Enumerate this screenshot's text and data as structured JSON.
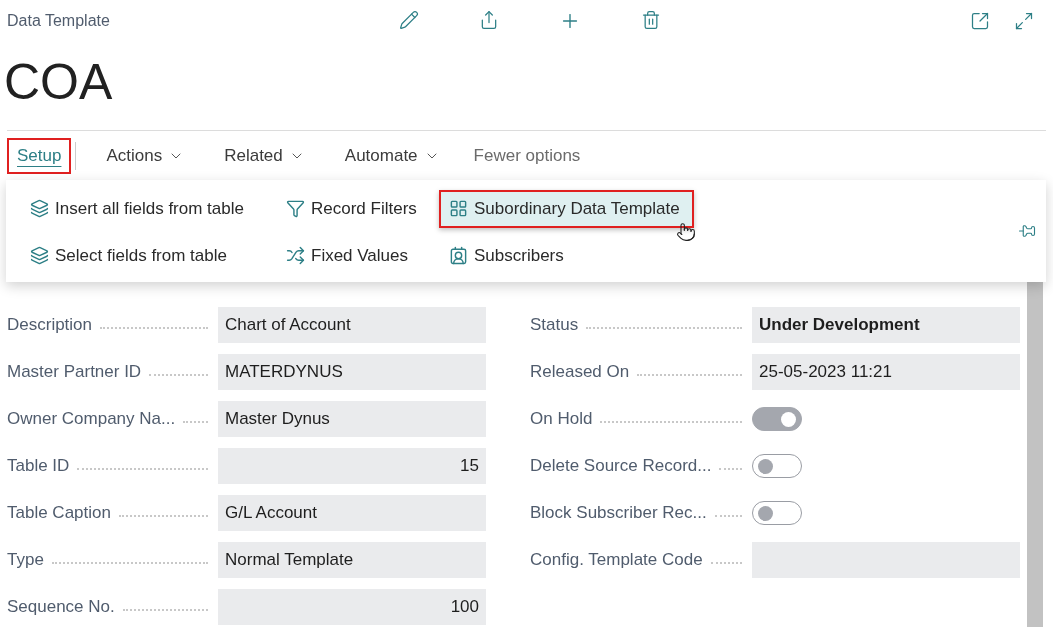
{
  "page": {
    "caption": "Data Template",
    "title": "COA"
  },
  "action_tabs": [
    {
      "label": "Setup",
      "selected": true,
      "annotated": true,
      "dropdown": false
    },
    {
      "label": "Actions",
      "selected": false,
      "annotated": false,
      "dropdown": true
    },
    {
      "label": "Related",
      "selected": false,
      "annotated": false,
      "dropdown": true
    },
    {
      "label": "Automate",
      "selected": false,
      "annotated": false,
      "dropdown": true
    }
  ],
  "fewer_options": "Fewer options",
  "menu_items": [
    {
      "label": "Insert all fields from table",
      "kind": "insert",
      "annotated": false,
      "hovered": false
    },
    {
      "label": "Record Filters",
      "kind": "filter",
      "annotated": false,
      "hovered": false
    },
    {
      "label": "Subordinary Data Template",
      "kind": "template",
      "annotated": true,
      "hovered": true
    },
    {
      "label": "Select fields from table",
      "kind": "insert",
      "annotated": false,
      "hovered": false
    },
    {
      "label": "Fixed Values",
      "kind": "fixed",
      "annotated": false,
      "hovered": false
    },
    {
      "label": "Subscribers",
      "kind": "subscribers",
      "annotated": false,
      "hovered": false
    }
  ],
  "left_fields": [
    {
      "label": "Description",
      "kind": "text",
      "value": "Chart of Account",
      "numeric": false,
      "emphasis": false
    },
    {
      "label": "Master Partner ID",
      "kind": "text",
      "value": "MATERDYNUS",
      "numeric": false,
      "emphasis": false
    },
    {
      "label": "Owner Company Na...",
      "kind": "text",
      "value": "Master Dynus",
      "numeric": false,
      "emphasis": false
    },
    {
      "label": "Table ID",
      "kind": "text",
      "value": "15",
      "numeric": true,
      "emphasis": false
    },
    {
      "label": "Table Caption",
      "kind": "text",
      "value": "G/L Account",
      "numeric": false,
      "emphasis": false
    },
    {
      "label": "Type",
      "kind": "text",
      "value": "Normal Template",
      "numeric": false,
      "emphasis": false
    },
    {
      "label": "Sequence No.",
      "kind": "text",
      "value": "100",
      "numeric": true,
      "emphasis": false
    }
  ],
  "right_fields": [
    {
      "label": "Status",
      "kind": "text",
      "value": "Under Development",
      "numeric": false,
      "emphasis": true
    },
    {
      "label": "Released On",
      "kind": "text",
      "value": "25-05-2023 11:21",
      "numeric": false,
      "emphasis": false
    },
    {
      "label": "On Hold",
      "kind": "toggle",
      "on": true
    },
    {
      "label": "Delete Source Record...",
      "kind": "toggle",
      "on": false
    },
    {
      "label": "Block Subscriber Rec...",
      "kind": "toggle",
      "on": false
    },
    {
      "label": "Config. Template Code",
      "kind": "blank"
    }
  ]
}
